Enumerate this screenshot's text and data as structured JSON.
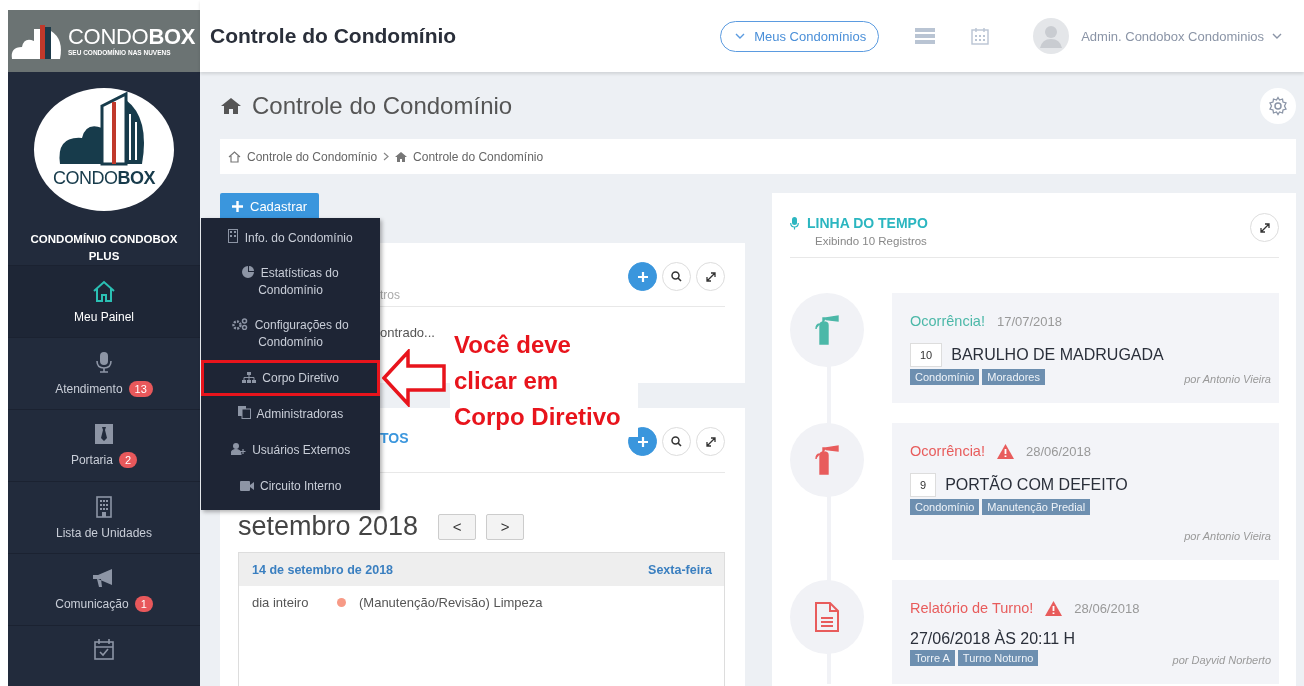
{
  "brand": {
    "light": "CONDO",
    "bold": "BOX",
    "tagline": "SEU CONDOMÍNIO NAS NUVENS"
  },
  "header": {
    "title": "Controle do Condomínio",
    "condos_button": "Meus Condomínios",
    "user": "Admin. Condobox Condominios"
  },
  "sidebar": {
    "logo_light": "CONDO",
    "logo_bold": "BOX",
    "condo_name": "CONDOMÍNIO CONDOBOX PLUS",
    "items": [
      {
        "label": "Meu Painel",
        "selected": true
      },
      {
        "label": "Atendimento",
        "badge": "13",
        "selected": false
      },
      {
        "label": "Portaria",
        "badge": "2",
        "selected": false
      },
      {
        "label": "Lista de Unidades",
        "selected": false
      },
      {
        "label": "Comunicação",
        "badge": "1",
        "selected": false
      },
      {
        "selected": false
      }
    ]
  },
  "page": {
    "title": "Controle do Condomínio",
    "breadcrumb": [
      "Controle do Condomínio",
      "Controle do Condomínio"
    ],
    "add_button": "Cadastrar"
  },
  "dropdown": {
    "items": [
      {
        "label": "Info. do Condomínio",
        "selected": false
      },
      {
        "label": "Estatísticas do Condomínio",
        "selected": false
      },
      {
        "label": "Configurações do Condomínio",
        "selected": false
      },
      {
        "label": "Corpo Diretivo",
        "selected": true
      },
      {
        "label": "Administradoras",
        "selected": false
      },
      {
        "label": "Usuários Externos",
        "selected": false
      },
      {
        "label": "Circuito Interno",
        "selected": false
      }
    ]
  },
  "annotation": "Você deve clicar em Corpo Diretivo",
  "card_1": {
    "subtitle": "tros",
    "body": "ontrado..."
  },
  "card_2": {
    "title": "TOS",
    "month": "setembro 2018",
    "prev": "<",
    "next": ">",
    "day": {
      "date": "14 de setembro de 2018",
      "weekday": "Sexta-feira",
      "events": [
        {
          "time": "dia inteiro",
          "text": "(Manutenção/Revisão) Limpeza",
          "color": "#f79a86"
        }
      ]
    }
  },
  "timeline": {
    "title": "LINHA DO TEMPO",
    "subtitle": "Exibindo 10 Registros",
    "entries": [
      {
        "kind": "occurrence",
        "type": "Ocorrência!",
        "color": "#4cb8a8",
        "alert": false,
        "date": "17/07/2018",
        "number": "10",
        "heading": "BARULHO DE MADRUGADA",
        "tags": [
          "Condomínio",
          "Moradores"
        ],
        "author": "por Antonio Vieira"
      },
      {
        "kind": "occurrence",
        "type": "Ocorrência!",
        "color": "#e85c5c",
        "alert": true,
        "date": "28/06/2018",
        "number": "9",
        "heading": "PORTÃO COM DEFEITO",
        "tags": [
          "Condomínio",
          "Manutenção Predial"
        ],
        "author": "por Antonio Vieira"
      },
      {
        "kind": "report",
        "type": "Relatório de Turno!",
        "color": "#e85c5c",
        "alert": true,
        "date": "28/06/2018",
        "heading": "27/06/2018 ÀS 20:11 H",
        "tags": [
          "Torre A",
          "Turno Noturno"
        ],
        "author": "por Dayvid Norberto"
      }
    ]
  }
}
